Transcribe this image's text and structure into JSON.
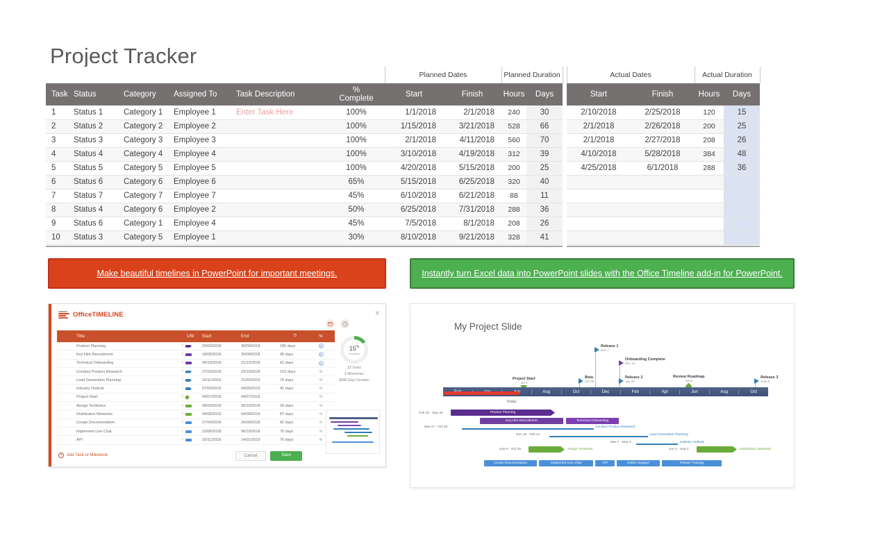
{
  "page_title": "Project Tracker",
  "tracker": {
    "group_headers": [
      {
        "label": "",
        "span": 6
      },
      {
        "label": "Planned Dates",
        "span": 2
      },
      {
        "label": "Planned Duration",
        "span": 2
      },
      {
        "label": "",
        "span": 1
      },
      {
        "label": "Actual Dates",
        "span": 2
      },
      {
        "label": "Actual Duration",
        "span": 2
      }
    ],
    "columns": [
      "Task",
      "Status",
      "Category",
      "Assigned To",
      "Task Description",
      "% Complete",
      "Start",
      "Finish",
      "Hours",
      "Days",
      "Start",
      "Finish",
      "Hours",
      "Days"
    ],
    "pct_header_line1": "%",
    "pct_header_line2": "Complete",
    "rows": [
      {
        "task": "1",
        "status": "Status 1",
        "category": "Category 1",
        "assigned": "Employee 1",
        "description": "Enter Task Here",
        "pct": "100%",
        "p_start": "1/1/2018",
        "p_finish": "2/1/2018",
        "p_hours": "240",
        "p_days": "30",
        "a_start": "2/10/2018",
        "a_finish": "2/25/2018",
        "a_hours": "120",
        "a_days": "15"
      },
      {
        "task": "2",
        "status": "Status 2",
        "category": "Category 2",
        "assigned": "Employee 2",
        "description": "",
        "pct": "100%",
        "p_start": "1/15/2018",
        "p_finish": "3/21/2018",
        "p_hours": "528",
        "p_days": "66",
        "a_start": "2/1/2018",
        "a_finish": "2/26/2018",
        "a_hours": "200",
        "a_days": "25"
      },
      {
        "task": "3",
        "status": "Status 3",
        "category": "Category 3",
        "assigned": "Employee 3",
        "description": "",
        "pct": "100%",
        "p_start": "2/1/2018",
        "p_finish": "4/11/2018",
        "p_hours": "560",
        "p_days": "70",
        "a_start": "2/1/2018",
        "a_finish": "2/27/2018",
        "a_hours": "208",
        "a_days": "26"
      },
      {
        "task": "4",
        "status": "Status 4",
        "category": "Category 4",
        "assigned": "Employee 4",
        "description": "",
        "pct": "100%",
        "p_start": "3/10/2018",
        "p_finish": "4/19/2018",
        "p_hours": "312",
        "p_days": "39",
        "a_start": "4/10/2018",
        "a_finish": "5/28/2018",
        "a_hours": "384",
        "a_days": "48"
      },
      {
        "task": "5",
        "status": "Status 5",
        "category": "Category 5",
        "assigned": "Employee 5",
        "description": "",
        "pct": "100%",
        "p_start": "4/20/2018",
        "p_finish": "5/15/2018",
        "p_hours": "200",
        "p_days": "25",
        "a_start": "4/25/2018",
        "a_finish": "6/1/2018",
        "a_hours": "288",
        "a_days": "36"
      },
      {
        "task": "6",
        "status": "Status 6",
        "category": "Category 6",
        "assigned": "Employee 6",
        "description": "",
        "pct": "65%",
        "p_start": "5/15/2018",
        "p_finish": "6/25/2018",
        "p_hours": "320",
        "p_days": "40",
        "a_start": "",
        "a_finish": "",
        "a_hours": "",
        "a_days": ""
      },
      {
        "task": "7",
        "status": "Status 7",
        "category": "Category 7",
        "assigned": "Employee 7",
        "description": "",
        "pct": "45%",
        "p_start": "6/10/2018",
        "p_finish": "6/21/2018",
        "p_hours": "88",
        "p_days": "11",
        "a_start": "",
        "a_finish": "",
        "a_hours": "",
        "a_days": ""
      },
      {
        "task": "8",
        "status": "Status 4",
        "category": "Category 6",
        "assigned": "Employee 2",
        "description": "",
        "pct": "50%",
        "p_start": "6/25/2018",
        "p_finish": "7/31/2018",
        "p_hours": "288",
        "p_days": "36",
        "a_start": "",
        "a_finish": "",
        "a_hours": "",
        "a_days": ""
      },
      {
        "task": "9",
        "status": "Status 6",
        "category": "Category 1",
        "assigned": "Employee 4",
        "description": "",
        "pct": "45%",
        "p_start": "7/5/2018",
        "p_finish": "8/1/2018",
        "p_hours": "208",
        "p_days": "26",
        "a_start": "",
        "a_finish": "",
        "a_hours": "",
        "a_days": ""
      },
      {
        "task": "10",
        "status": "Status 3",
        "category": "Category 5",
        "assigned": "Employee 1",
        "description": "",
        "pct": "30%",
        "p_start": "8/10/2018",
        "p_finish": "9/21/2018",
        "p_hours": "328",
        "p_days": "41",
        "a_start": "",
        "a_finish": "",
        "a_hours": "",
        "a_days": ""
      }
    ]
  },
  "banners": {
    "red": "Make beautiful timelines in PowerPoint for important meetings.",
    "green": "Instantly turn Excel data into PowerPoint slides with the Office Timeline add-in for PowerPoint."
  },
  "office_timeline_app": {
    "brand": "OfficeTIMELINE",
    "close_icon": "close-icon",
    "columns": {
      "title": "Title",
      "um": "1/M",
      "start": "Start",
      "end": "End",
      "duration": "clock-icon",
      "percent": "%"
    },
    "rows": [
      {
        "title": "Product Planning",
        "start": "29/03/2018",
        "end": "30/09/2018",
        "duration": "185 days",
        "pct": "35",
        "color": "#5b2d8e",
        "shape": "arrow"
      },
      {
        "title": "Key Hire Recruitment",
        "start": "18/05/2018",
        "end": "30/09/2018",
        "duration": "90 days",
        "pct": "49",
        "color": "#6f3fa0",
        "shape": "bar"
      },
      {
        "title": "Technical Onboarding",
        "start": "09/10/2018",
        "end": "21/12/2018",
        "duration": "61 days",
        "pct": "40",
        "color": "#6f3fa0",
        "shape": "bar"
      },
      {
        "title": "Conduct Product Research",
        "start": "27/03/2018",
        "end": "23/10/2018",
        "duration": "153 days",
        "pct": "",
        "color": "#2f7fb5",
        "shape": "arrow"
      },
      {
        "title": "Lead Generation Planning",
        "start": "16/11/2018",
        "end": "21/02/2019",
        "duration": "70 days",
        "pct": "",
        "color": "#2f7fb5",
        "shape": "arrow"
      },
      {
        "title": "Industry Outlook",
        "start": "07/03/2019",
        "end": "04/05/2019",
        "duration": "42 days",
        "pct": "",
        "color": "#2f7fb5",
        "shape": "arrow"
      },
      {
        "title": "Project Start",
        "start": "04/07/2018",
        "end": "04/07/2018",
        "duration": "",
        "pct": "",
        "color": "#6aab3a",
        "shape": "dia"
      },
      {
        "title": "Assign Territories",
        "start": "08/09/2018",
        "end": "30/10/2018",
        "duration": "39 days",
        "pct": "",
        "color": "#6aab3a",
        "shape": "bar"
      },
      {
        "title": "Distribution Networks",
        "start": "04/06/2019",
        "end": "04/09/2019",
        "duration": "87 days",
        "pct": "",
        "color": "#6aab3a",
        "shape": "bar"
      },
      {
        "title": "Create Documentation",
        "start": "27/04/2018",
        "end": "26/09/2018",
        "duration": "82 days",
        "pct": "",
        "color": "#4a90d9",
        "shape": "bar"
      },
      {
        "title": "Implement Live Chat",
        "start": "23/06/2018",
        "end": "06/10/2018",
        "duration": "70 days",
        "pct": "",
        "color": "#4a90d9",
        "shape": "bar"
      },
      {
        "title": "API",
        "start": "10/11/2018",
        "end": "14/01/2019",
        "duration": "76 days",
        "pct": "",
        "color": "#4a90d9",
        "shape": "bar"
      }
    ],
    "stats": {
      "percent": "15",
      "percent_sup": "%",
      "complete_label": "Complete",
      "tasks": "12",
      "tasks_label": "Tasks",
      "milestones": "1",
      "milestones_label": "Milestones",
      "duration": "1016",
      "duration_label": "Days Duration"
    },
    "add_label": "Add Task or Milestone",
    "cancel_label": "Cancel",
    "save_label": "Save"
  },
  "slide": {
    "title": "My Project Slide",
    "axis_months": [
      "Feb",
      "Apr",
      "Jun",
      "Aug",
      "Oct",
      "Dec",
      "Feb",
      "Apr",
      "Jun",
      "Aug",
      "Oct"
    ],
    "today_label": "Today",
    "milestones": [
      {
        "name": "Project Start",
        "date": "Jul 4",
        "type": "down-green"
      },
      {
        "name": "Beta",
        "date": "Oct 30",
        "type": "flag-blue"
      },
      {
        "name": "Release 1",
        "date": "Dec 7",
        "type": "flag-blue"
      },
      {
        "name": "Onboarding Complete",
        "date": "Dec 44",
        "type": "flag-purple"
      },
      {
        "name": "Release 2",
        "date": "Jan 30",
        "type": "flag-blue"
      },
      {
        "name": "Review Roadmap",
        "date": "Jun 6",
        "type": "diamond-green"
      },
      {
        "name": "Release 3",
        "date": "June 5",
        "type": "flag-blue"
      }
    ],
    "tasks": [
      {
        "name": "Product Planning",
        "range": "Feb 15 - Sep 30",
        "style": "bar-purple-arrow"
      },
      {
        "name": "Key Hire Recruitment",
        "range": "",
        "style": "bar-purple"
      },
      {
        "name": "Technical Onboarding",
        "range": "",
        "style": "bar-purple"
      },
      {
        "name": "Conduct Product Research",
        "range": "Mar 27 - Oct 25",
        "style": "line-blue"
      },
      {
        "name": "Lead Generation Planning",
        "range": "Nov 16 - Feb 21",
        "style": "line-blue"
      },
      {
        "name": "Industry Outlook",
        "range": "Mar 7 - May 4",
        "style": "line-blue"
      },
      {
        "name": "Assign Territories",
        "range": "Sep 5 - Oct 30",
        "style": "bar-green-arrow"
      },
      {
        "name": "Distribution Networks",
        "range": "Jun 4 - Sep 4",
        "style": "bar-green-arrow"
      }
    ],
    "chip_tasks": [
      "Create Documentation",
      "Implement Live Chat",
      "API",
      "Online Support",
      "Partner Training"
    ]
  },
  "colors": {
    "header_gray": "#767171",
    "red_banner": "#d9421b",
    "green_banner": "#4caf50",
    "actual_days_blue": "#dbe2f1",
    "accent_purple": "#6f3fa0",
    "accent_blue": "#4a90d9",
    "accent_green": "#6aab3a"
  }
}
